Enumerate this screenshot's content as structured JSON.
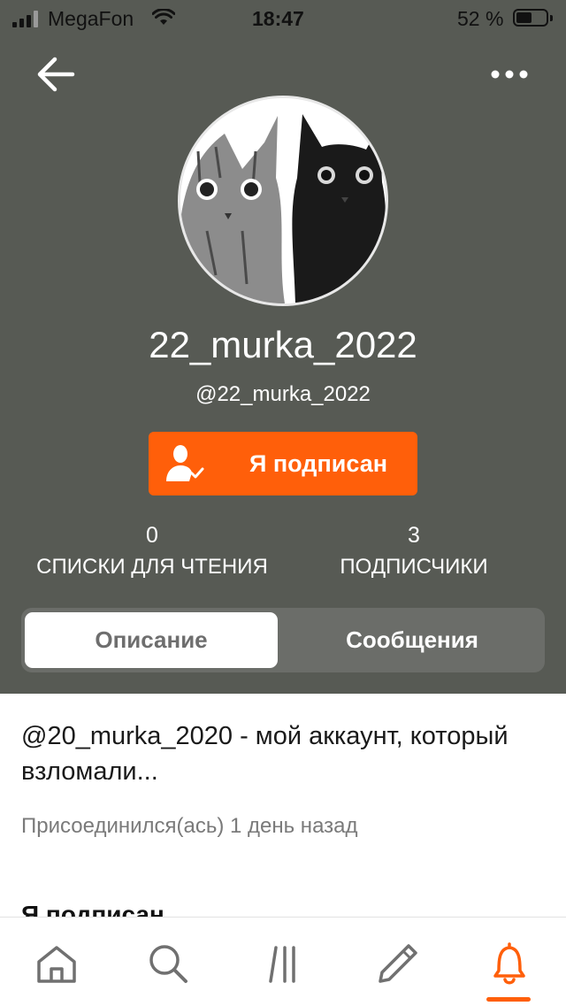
{
  "status_bar": {
    "carrier": "MegaFon",
    "time": "18:47",
    "battery_percent": "52 %",
    "battery_level": 0.52,
    "signal_bars": 3
  },
  "nav": {
    "back_icon": "arrow-left-icon",
    "more_icon": "more-horizontal-icon"
  },
  "profile": {
    "display_name": "22_murka_2022",
    "handle": "@22_murka_2022",
    "follow_button_label": "Я подписан",
    "follow_icon": "user-check-icon",
    "stats": {
      "reading_lists": {
        "value": "0",
        "label": "СПИСКИ ДЛЯ ЧТЕНИЯ"
      },
      "followers": {
        "value": "3",
        "label": "ПОДПИСЧИКИ"
      }
    }
  },
  "tabs": {
    "description": "Описание",
    "messages": "Сообщения"
  },
  "about": {
    "bio": "@20_murka_2020 - мой аккаунт, который взломали...",
    "joined": "Присоединился(ась) 1 день назад",
    "following_heading": "Я подписан"
  },
  "bottom_nav": {
    "items": [
      "home-icon",
      "search-icon",
      "library-icon",
      "write-icon",
      "notifications-icon"
    ],
    "active": "notifications-icon"
  },
  "colors": {
    "accent": "#ff5f0a",
    "header_bg": "#575a54"
  }
}
